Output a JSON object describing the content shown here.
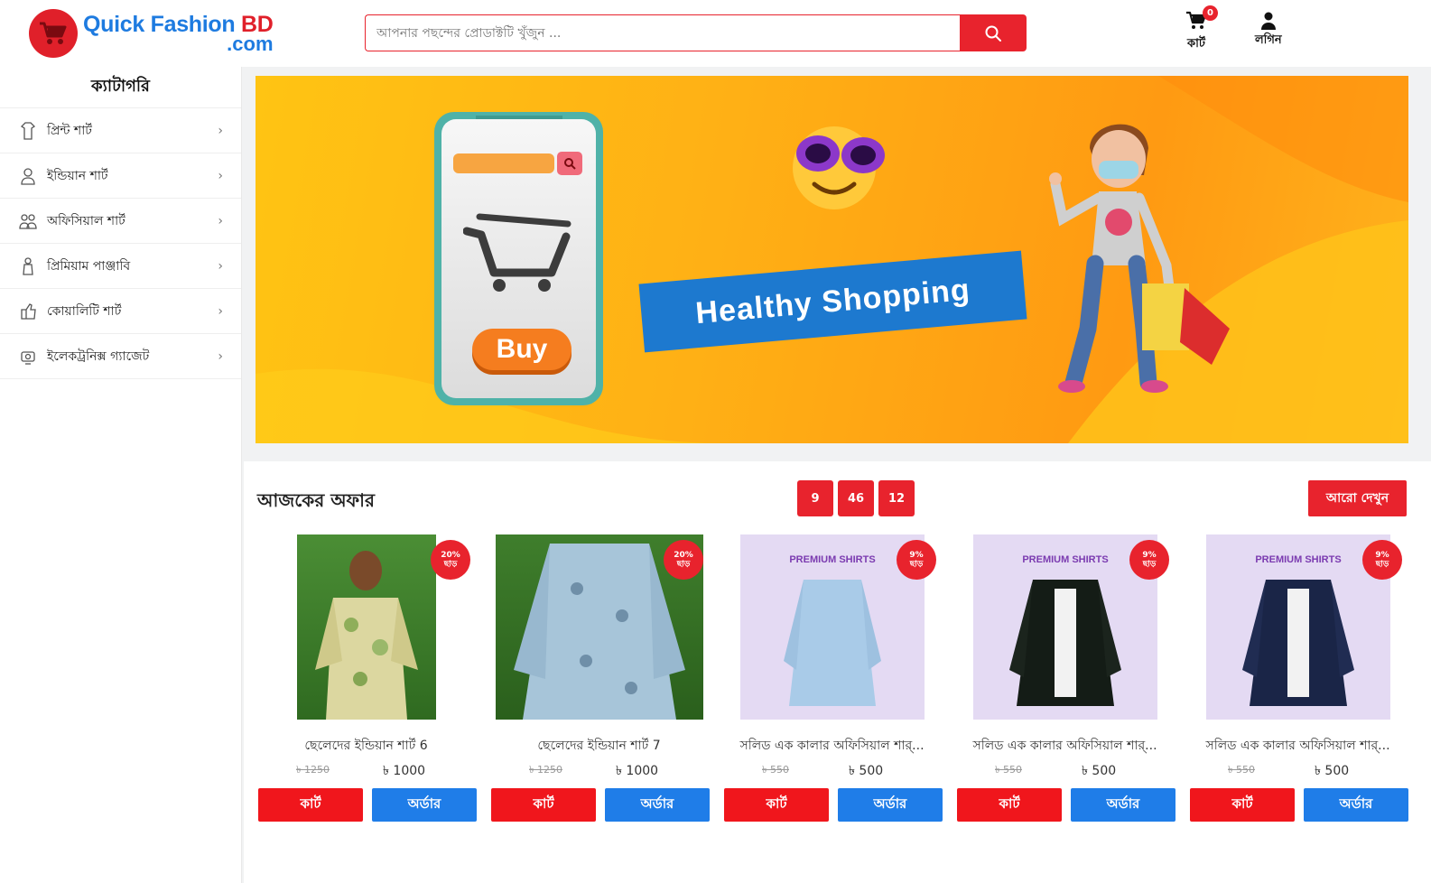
{
  "header": {
    "logo_line1": "Quick Fashion",
    "logo_bd": " BD",
    "logo_line2": ".com",
    "search_placeholder": "আপনার পছন্দের প্রোডাক্টটি খুঁজুন ...",
    "cart_label": "কার্ট",
    "cart_count": "0",
    "login_label": "লগিন"
  },
  "sidebar": {
    "title": "ক্যাটাগরি",
    "items": [
      {
        "label": "প্রিন্ট শার্ট",
        "icon": "shirt-icon"
      },
      {
        "label": "ইন্ডিয়ান শার্ট",
        "icon": "person-icon"
      },
      {
        "label": "অফিসিয়াল শার্ট",
        "icon": "people-icon"
      },
      {
        "label": "প্রিমিয়াম পাঞ্জাবি",
        "icon": "panjabi-icon"
      },
      {
        "label": "কোয়ালিটি শার্ট",
        "icon": "quality-icon"
      },
      {
        "label": "ইলেকট্রনিক্স গ্যাজেট",
        "icon": "gadget-icon"
      }
    ]
  },
  "banner": {
    "headline": "Healthy Shopping",
    "buy_label": "Buy"
  },
  "offers": {
    "title": "আজকের অফার",
    "timer": [
      "9",
      "46",
      "12"
    ],
    "see_more": "আরো দেখুন",
    "products": [
      {
        "name": "ছেলেদের ইন্ডিয়ান শার্ট 6",
        "old_price": "৳ 1250",
        "price": "৳ 1000",
        "discount_pct": "20%",
        "discount_word": "ছাড়",
        "cart": "কার্ট",
        "order": "অর্ডার"
      },
      {
        "name": "ছেলেদের ইন্ডিয়ান শার্ট 7",
        "old_price": "৳ 1250",
        "price": "৳ 1000",
        "discount_pct": "20%",
        "discount_word": "ছাড়",
        "cart": "কার্ট",
        "order": "অর্ডার"
      },
      {
        "name": "সলিড এক কালার অফিসিয়াল শার্...",
        "old_price": "৳ 550",
        "price": "৳ 500",
        "discount_pct": "9%",
        "discount_word": "ছাড়",
        "cart": "কার্ট",
        "order": "অর্ডার",
        "img_label": "PREMIUM SHIRTS"
      },
      {
        "name": "সলিড এক কালার অফিসিয়াল শার্...",
        "old_price": "৳ 550",
        "price": "৳ 500",
        "discount_pct": "9%",
        "discount_word": "ছাড়",
        "cart": "কার্ট",
        "order": "অর্ডার",
        "img_label": "PREMIUM SHIRTS"
      },
      {
        "name": "সলিড এক কালার অফিসিয়াল শার্...",
        "old_price": "৳ 550",
        "price": "৳ 500",
        "discount_pct": "9%",
        "discount_word": "ছাড়",
        "cart": "কার্ট",
        "order": "অর্ডার",
        "img_label": "PREMIUM SHIRTS"
      }
    ]
  },
  "colors": {
    "brand_red": "#e8232d",
    "brand_blue": "#1e7be0",
    "order_blue": "#1f7de8"
  }
}
